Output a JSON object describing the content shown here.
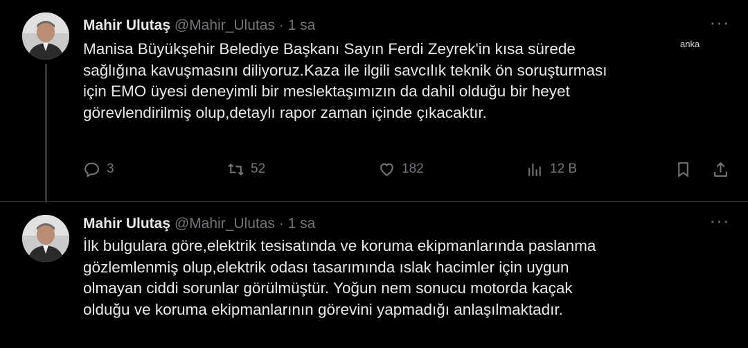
{
  "tweets": [
    {
      "author_name": "Mahir Ulutaş",
      "handle": "@Mahir_Ulutas",
      "separator": "·",
      "time": "1 sa",
      "lines": [
        "Manisa Büyükşehir Belediye Başkanı Sayın Ferdi Zeyrek'in kısa sürede",
        "sağlığına kavuşmasını diliyoruz.Kaza ile ilgili savcılık teknik ön soruşturması",
        "için EMO üyesi deneyimli bir meslektaşımızın da dahil olduğu bir heyet",
        "görevlendirilmiş olup,detaylı rapor zaman içinde çıkacaktır."
      ],
      "stats": {
        "replies": "3",
        "reposts": "52",
        "likes": "182",
        "views": "12 B"
      }
    },
    {
      "author_name": "Mahir Ulutaş",
      "handle": "@Mahir_Ulutas",
      "separator": "·",
      "time": "1 sa",
      "lines": [
        "İlk bulgulara göre,elektrik tesisatında ve koruma ekipmanlarında paslanma",
        "gözlemlenmiş olup,elektrik odası tasarımında ıslak hacimler için uygun",
        "olmayan ciddi sorunlar görülmüştür. Yoğun nem sonucu motorda kaçak",
        "olduğu ve koruma ekipmanlarının görevini yapmadığı anlaşılmaktadır."
      ]
    }
  ],
  "more_glyph": "···",
  "watermark": "anka",
  "icons": {
    "reply": "reply-icon",
    "repost": "repost-icon",
    "like": "heart-icon",
    "views": "views-icon",
    "bookmark": "bookmark-icon",
    "share": "share-icon",
    "more": "more-icon"
  },
  "colors": {
    "background": "#000000",
    "text": "#e7e9ea",
    "muted": "#71767b",
    "border": "#2f3336"
  }
}
